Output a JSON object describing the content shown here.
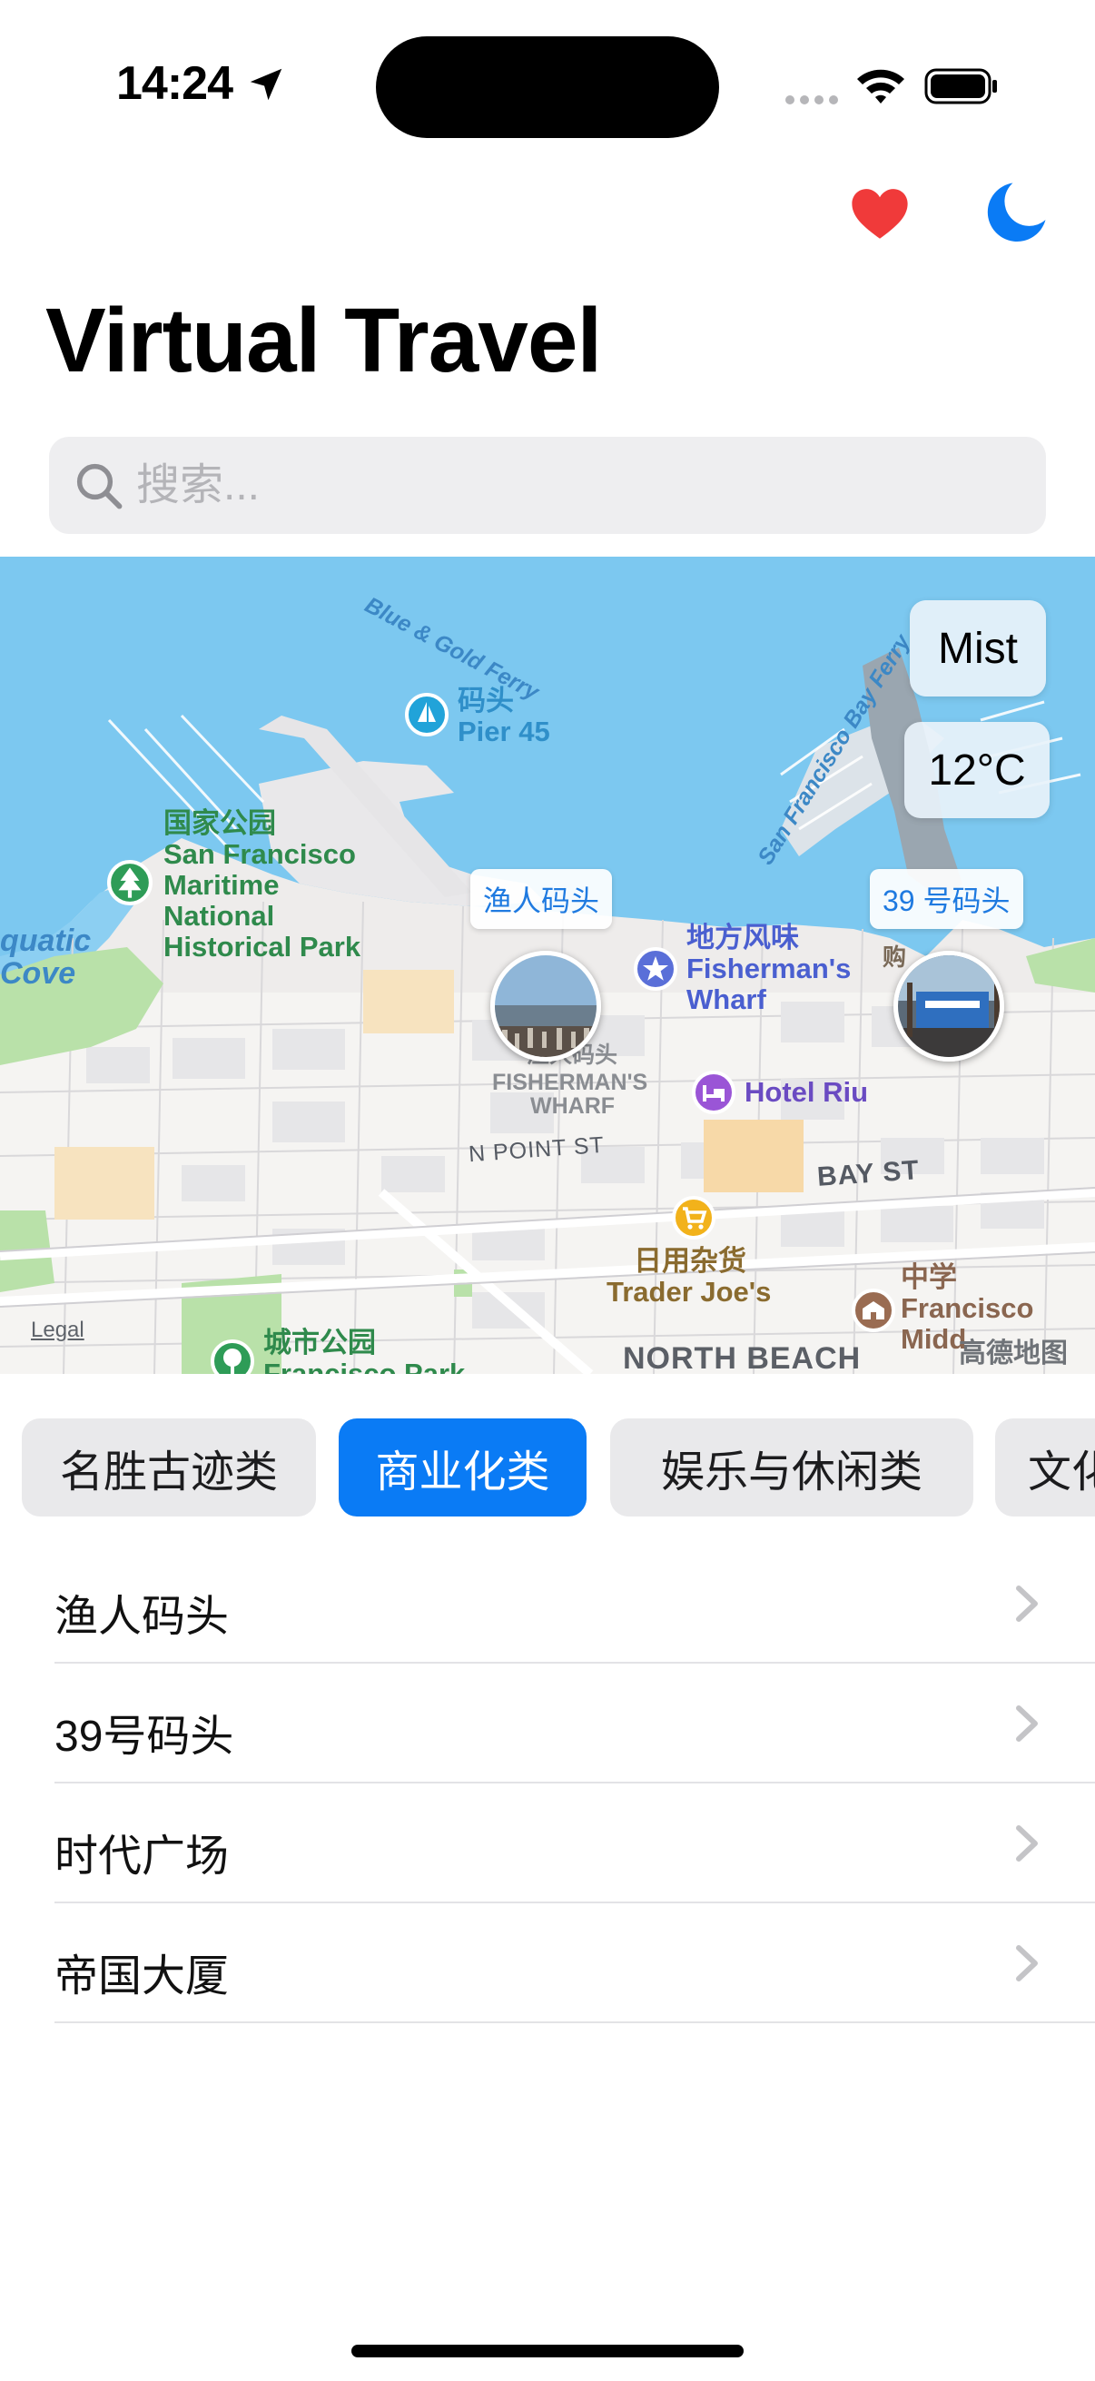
{
  "status_bar": {
    "time": "14:24",
    "icons": [
      "location-arrow-icon",
      "cellular-dots-icon",
      "wifi-icon",
      "battery-icon"
    ]
  },
  "toolbar": {
    "favorites_icon": "heart-icon",
    "theme_icon": "moon-icon",
    "colors": {
      "heart": "#f03a3a",
      "moon": "#0a7bf5"
    }
  },
  "page_title": "Virtual Travel",
  "search": {
    "placeholder": "搜索...",
    "value": ""
  },
  "map": {
    "weather": {
      "condition": "Mist",
      "temperature": "12°C"
    },
    "pins": [
      {
        "label": "渔人码头"
      },
      {
        "label": "39 号码头"
      }
    ],
    "labels": {
      "ferry_blue_gold": "Blue & Gold Ferry",
      "ferry_sf_bay": "San Francisco Bay Ferry",
      "pier45_cn": "码头",
      "pier45_en": "Pier 45",
      "aquatic": "quatic",
      "cove": "Cove",
      "park_cn": "国家公园",
      "park_en_1": "San Francisco",
      "park_en_2": "Maritime",
      "park_en_3": "National",
      "park_en_4": "Historical Park",
      "fw_cn": "地方风味",
      "fw_en_1": "Fisherman's",
      "fw_en_2": "Wharf",
      "fw_district_cn": "渔人码头",
      "fw_district_1": "FISHERMAN'S",
      "fw_district_2": "WHARF",
      "hotel": "Hotel Riu",
      "npoint": "N POINT ST",
      "bay": "BAY ST",
      "tj_cn": "日用杂货",
      "tj_en": "Trader Joe's",
      "school_cn": "中学",
      "school_en_1": "Francisco",
      "school_en_2": "Midd",
      "city_park_cn": "城市公园",
      "city_park_en": "Francisco Park",
      "north_beach": "NORTH BEACH",
      "buy_cn": "购",
      "legal": "Legal",
      "provider": "高德地图"
    }
  },
  "categories": [
    {
      "label": "名胜古迹类",
      "active": false
    },
    {
      "label": "商业化类",
      "active": true
    },
    {
      "label": "娱乐与休闲类",
      "active": false
    },
    {
      "label": "文化",
      "active": false
    }
  ],
  "places": [
    {
      "name": "渔人码头"
    },
    {
      "name": "39号码头"
    },
    {
      "name": "时代广场"
    },
    {
      "name": "帝国大厦"
    }
  ]
}
